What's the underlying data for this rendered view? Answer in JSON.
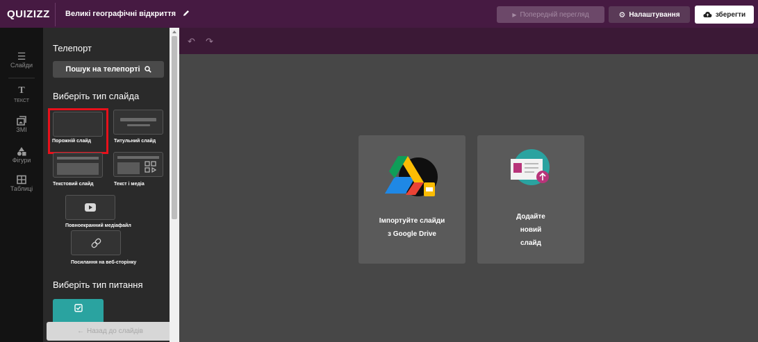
{
  "header": {
    "logo": "QUIZIZZ",
    "quiz_title": "Великі географічні відкриття",
    "preview_label": "Попередній перегляд",
    "settings_label": "Налаштування",
    "save_label": "зберегти"
  },
  "sidebar_tools": [
    {
      "label": "Слайди",
      "icon": "slides-icon"
    },
    {
      "label": "ТЕКСТ",
      "icon": "text-icon"
    },
    {
      "label": "ЗМІ",
      "icon": "media-icon"
    },
    {
      "label": "Фігури",
      "icon": "shapes-icon"
    },
    {
      "label": "Таблиці",
      "icon": "table-icon"
    }
  ],
  "panel": {
    "teleport_heading": "Телепорт",
    "teleport_search_label": "Пошук на телепорті",
    "slide_type_heading": "Виберіть тип слайда",
    "slide_types": [
      {
        "label": "Порожній слайд"
      },
      {
        "label": "Титульний слайд"
      },
      {
        "label": "Текстовий слайд"
      },
      {
        "label": "Текст і медіа"
      },
      {
        "label": "Повноекранний медіафайл"
      },
      {
        "label": "Посилання на веб-сторінку"
      }
    ],
    "question_type_heading": "Виберіть тип питання",
    "back_label": "Назад до слайдів"
  },
  "canvas": {
    "import_card": {
      "line1": "Імпортуйте слайди",
      "line2": "з Google Drive"
    },
    "add_card": {
      "line1": "Додайте",
      "line2": "новий",
      "line3": "слайд"
    }
  },
  "colors": {
    "header_bg": "#461a42",
    "highlight": "#e8101b",
    "question_teal": "#2aa3a0"
  }
}
